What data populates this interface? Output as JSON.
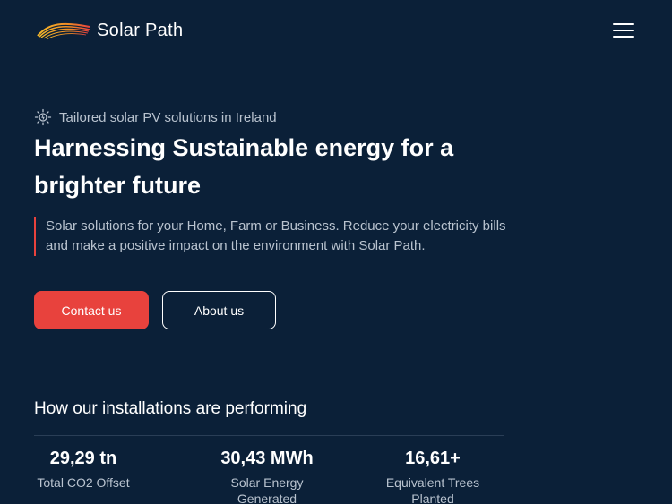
{
  "header": {
    "brand": "Solar Path",
    "logo_icon": "solar-wave-logo",
    "menu_icon": "hamburger-menu-icon"
  },
  "hero": {
    "tagline_icon": "sun-icon",
    "tagline": "Tailored solar PV solutions in Ireland",
    "title": "Harnessing Sustainable energy for a brighter future",
    "description": "Solar solutions for your Home, Farm or Business. Reduce your electricity bills and make a positive impact on the environment with Solar Path.",
    "contact_label": "Contact us",
    "about_label": "About us"
  },
  "stats": {
    "title": "How our installations are performing",
    "items": [
      {
        "value": "29,29 tn",
        "label": "Total CO2 Offset"
      },
      {
        "value": "30,43 MWh",
        "label": "Solar Energy Generated"
      },
      {
        "value": "16,61+",
        "label": "Equivalent Trees Planted"
      }
    ]
  },
  "colors": {
    "background": "#0b2038",
    "accent": "#e8423d",
    "muted_text": "#b9c3cf"
  }
}
